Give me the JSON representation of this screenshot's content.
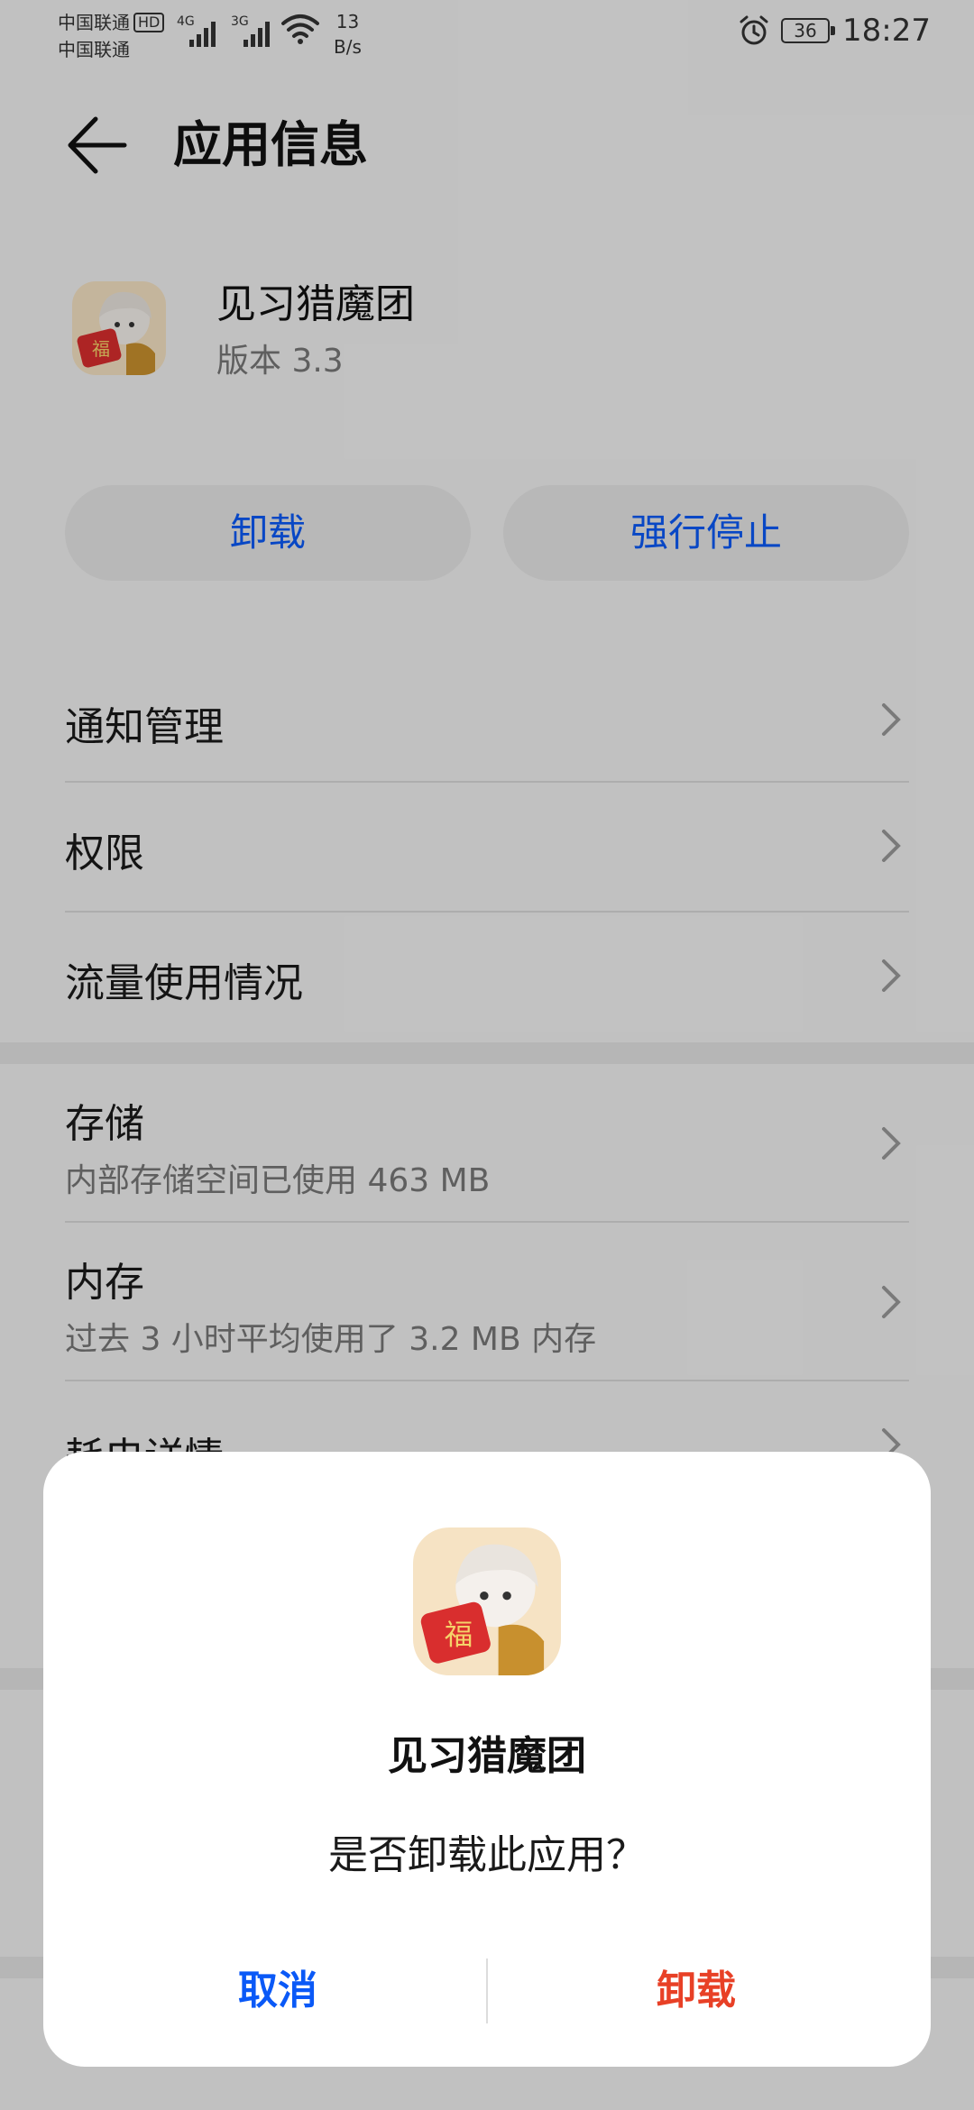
{
  "status_bar": {
    "carrier_1": "中国联通",
    "carrier_1_badge": "HD",
    "carrier_2": "中国联通",
    "signal_1_tag": "4G",
    "signal_2_tag": "3G",
    "net_speed_value": "13",
    "net_speed_unit": "B/s",
    "battery_level": "36",
    "time": "18:27"
  },
  "header": {
    "title": "应用信息",
    "back_icon": "arrow-left-icon"
  },
  "app": {
    "name": "见习猎魔团",
    "version": "版本 3.3",
    "icon": "app-icon"
  },
  "actions": {
    "uninstall": "卸载",
    "force_stop": "强行停止"
  },
  "settings": [
    {
      "label": "通知管理"
    },
    {
      "label": "权限"
    },
    {
      "label": "流量使用情况"
    },
    {
      "label": "存储",
      "detail": "内部存储空间已使用 463 MB"
    },
    {
      "label": "内存",
      "detail": "过去 3 小时平均使用了 3.2 MB 内存"
    },
    {
      "label": "耗电详情"
    }
  ],
  "dialog": {
    "app_name": "见习猎魔团",
    "message": "是否卸载此应用？",
    "cancel": "取消",
    "confirm": "卸载"
  },
  "colors": {
    "accent_blue": "#0a59f7",
    "danger_red": "#e84026",
    "background": "#f2f2f2"
  }
}
